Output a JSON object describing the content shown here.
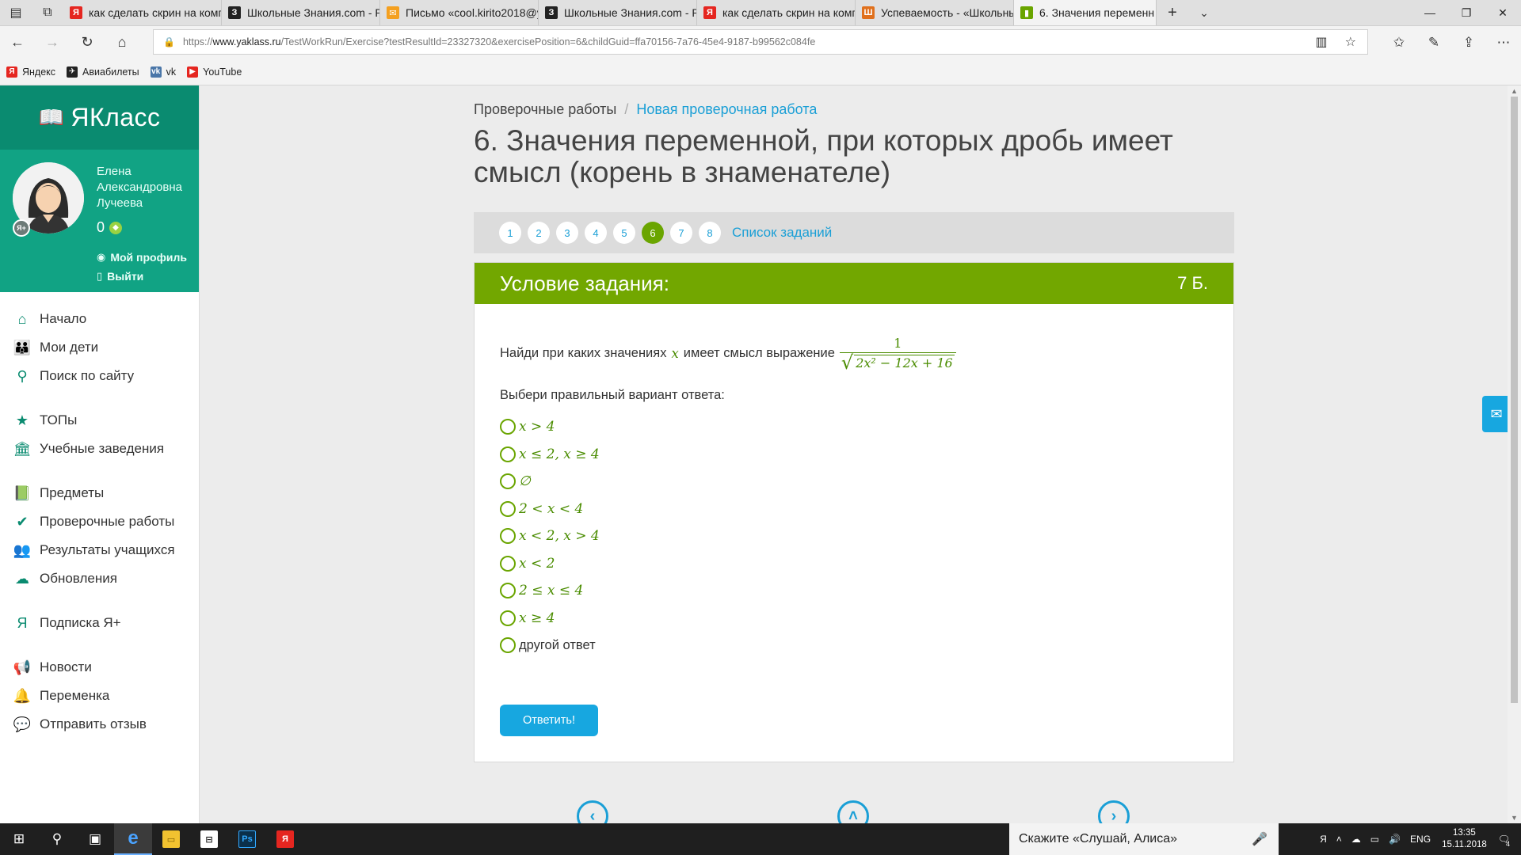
{
  "browser": {
    "tabs": [
      {
        "label": "как сделать скрин на комп",
        "fav": "Я",
        "fav_color": "#e52620"
      },
      {
        "label": "Школьные Знания.com - Р",
        "fav": "З",
        "fav_color": "#222222"
      },
      {
        "label": "Письмо «cool.kirito2018@y",
        "fav": "✉",
        "fav_color": "#f4a020"
      },
      {
        "label": "Школьные Знания.com - Р",
        "fav": "З",
        "fav_color": "#222222"
      },
      {
        "label": "как сделать скрин на комп",
        "fav": "Я",
        "fav_color": "#e52620"
      },
      {
        "label": "Успеваемость - «Школьны",
        "fav": "Ш",
        "fav_color": "#e0701c"
      }
    ],
    "active_tab": {
      "label": "6. Значения переменн",
      "fav_color": "#6aa500"
    },
    "url_prefix": "https://",
    "url_host": "www.yaklass.ru",
    "url_path": "/TestWorkRun/Exercise?testResultId=23327320&exercisePosition=6&childGuid=ffa70156-7a76-45e4-9187-b99562c084fe",
    "favorites": [
      {
        "label": "Яндекс",
        "icon": "Я",
        "color": "#e52620"
      },
      {
        "label": "Авиабилеты",
        "icon": "✈",
        "color": "#222222"
      },
      {
        "label": "vk",
        "icon": "vk",
        "color": "#4a76a8"
      },
      {
        "label": "YouTube",
        "icon": "▶",
        "color": "#e52620"
      }
    ]
  },
  "sidebar": {
    "brand": "ЯКласс",
    "profile": {
      "name_line1": "Елена",
      "name_line2": "Александровна",
      "name_line3": "Лучеева",
      "points": "0",
      "my_profile": "Мой профиль",
      "logout": "Выйти"
    },
    "groups": [
      [
        {
          "label": "Начало",
          "icon": "⌂"
        },
        {
          "label": "Мои дети",
          "icon": "👪"
        },
        {
          "label": "Поиск по сайту",
          "icon": "⚲"
        }
      ],
      [
        {
          "label": "ТОПы",
          "icon": "★"
        },
        {
          "label": "Учебные заведения",
          "icon": "🏛"
        }
      ],
      [
        {
          "label": "Предметы",
          "icon": "📗"
        },
        {
          "label": "Проверочные работы",
          "icon": "✔"
        },
        {
          "label": "Результаты учащихся",
          "icon": "👥"
        },
        {
          "label": "Обновления",
          "icon": "☁"
        }
      ],
      [
        {
          "label": "Подписка Я+",
          "icon": "Я"
        }
      ],
      [
        {
          "label": "Новости",
          "icon": "📢"
        },
        {
          "label": "Переменка",
          "icon": "🔔"
        },
        {
          "label": "Отправить отзыв",
          "icon": "💬"
        }
      ]
    ]
  },
  "main": {
    "breadcrumb_root": "Проверочные работы",
    "breadcrumb_sep": "/",
    "breadcrumb_link": "Новая проверочная работа",
    "title": "6. Значения переменной, при которых дробь имеет смысл (корень в знаменателе)",
    "pager": [
      "1",
      "2",
      "3",
      "4",
      "5",
      "6",
      "7",
      "8"
    ],
    "current_page": "6",
    "task_list": "Список заданий",
    "card": {
      "header": "Условие задания:",
      "score": "7 Б.",
      "question_before": "Найди при каких значениях",
      "variable": "x",
      "question_after": "имеет смысл выражение",
      "frac_num": "1",
      "frac_den": "2x² − 12x + 16",
      "prompt": "Выбери правильный вариант ответа:",
      "options": [
        {
          "text": "x > 4",
          "math": true
        },
        {
          "text": "x ≤ 2, x ≥ 4",
          "math": true
        },
        {
          "text": "∅",
          "math": true
        },
        {
          "text": "2 < x < 4",
          "math": true
        },
        {
          "text": "x < 2, x > 4",
          "math": true
        },
        {
          "text": "x < 2",
          "math": true
        },
        {
          "text": "2 ≤ x ≤ 4",
          "math": true
        },
        {
          "text": "x ≥ 4",
          "math": true
        },
        {
          "text": "другой ответ",
          "math": false
        }
      ],
      "submit": "Ответить!"
    }
  },
  "taskbar": {
    "alice_placeholder": "Скажите «Слушай, Алиса»",
    "lang": "ENG",
    "time": "13:35",
    "date": "15.11.2018",
    "notif_count": "4"
  }
}
